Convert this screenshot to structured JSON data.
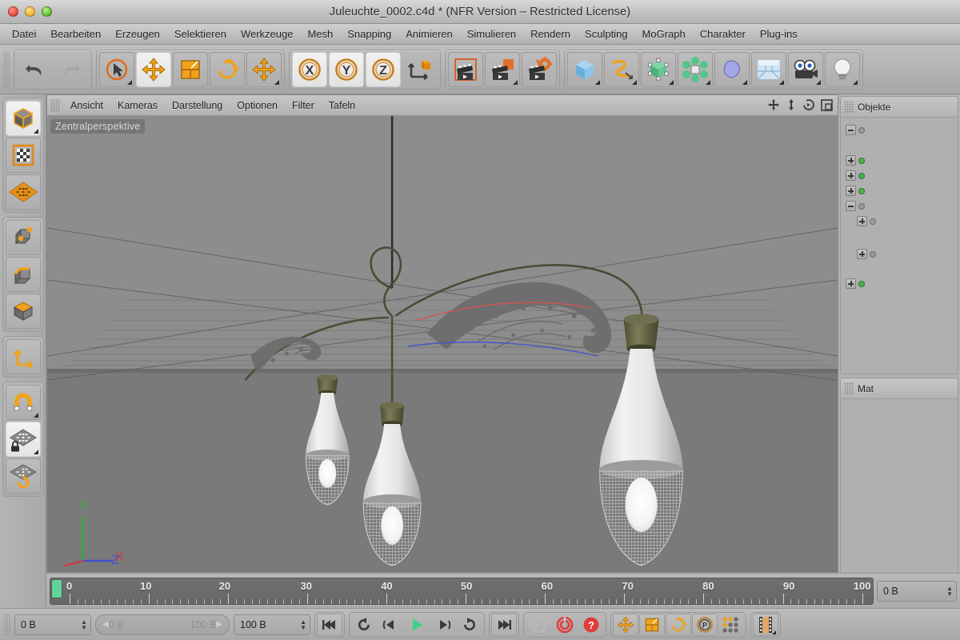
{
  "window": {
    "title": "Juleuchte_0002.c4d * (NFR Version – Restricted License)",
    "traffic": {
      "close": "close-button",
      "minimize": "minimize-button",
      "zoom": "zoom-button"
    }
  },
  "menubar": {
    "items": [
      {
        "label": "Datei"
      },
      {
        "label": "Bearbeiten"
      },
      {
        "label": "Erzeugen"
      },
      {
        "label": "Selektieren"
      },
      {
        "label": "Werkzeuge"
      },
      {
        "label": "Mesh"
      },
      {
        "label": "Snapping"
      },
      {
        "label": "Animieren"
      },
      {
        "label": "Simulieren"
      },
      {
        "label": "Rendern"
      },
      {
        "label": "Sculpting"
      },
      {
        "label": "MoGraph"
      },
      {
        "label": "Charakter"
      },
      {
        "label": "Plug-ins"
      }
    ]
  },
  "toolbar": {
    "groups": [
      {
        "name": "history",
        "buttons": [
          {
            "name": "undo-icon",
            "label": "Rückgängig"
          },
          {
            "name": "redo-icon",
            "label": "Wiederherstellen"
          }
        ]
      },
      {
        "name": "transform-tools",
        "buttons": [
          {
            "name": "select-live-icon",
            "label": "Selektion"
          },
          {
            "name": "move-icon",
            "label": "Verschieben"
          },
          {
            "name": "scale-icon",
            "label": "Skalieren"
          },
          {
            "name": "rotate-icon",
            "label": "Drehen"
          },
          {
            "name": "move-alt-icon",
            "label": "Verschieben (Alt)"
          }
        ]
      },
      {
        "name": "axis-locks",
        "buttons": [
          {
            "name": "axis-x-icon",
            "label": "X"
          },
          {
            "name": "axis-y-icon",
            "label": "Y"
          },
          {
            "name": "axis-z-icon",
            "label": "Z"
          },
          {
            "name": "world-object-coords-icon",
            "label": "Welt-/Objektsystem"
          }
        ]
      },
      {
        "name": "render-tools",
        "buttons": [
          {
            "name": "render-view-icon",
            "label": "Ansicht rendern"
          },
          {
            "name": "render-region-icon",
            "label": "Bereich rendern"
          },
          {
            "name": "render-settings-icon",
            "label": "Rendervoreinstellungen"
          }
        ]
      },
      {
        "name": "create-tools",
        "buttons": [
          {
            "name": "cube-primitive-icon",
            "label": "Grundobjekt"
          },
          {
            "name": "spline-icon",
            "label": "Spline"
          },
          {
            "name": "generator-icon",
            "label": "NURBS"
          },
          {
            "name": "array-icon",
            "label": "Modeling-Objekt"
          },
          {
            "name": "deformer-icon",
            "label": "Deformer"
          },
          {
            "name": "environment-icon",
            "label": "Szenenobjekt"
          },
          {
            "name": "camera-icon",
            "label": "Kamera"
          },
          {
            "name": "light-icon",
            "label": "Licht"
          }
        ]
      }
    ]
  },
  "left_palette": {
    "groups": [
      {
        "name": "mode-group-1",
        "buttons": [
          {
            "name": "object-mode-icon",
            "label": "Objekt-Modus"
          },
          {
            "name": "texture-mode-icon",
            "label": "Textur-Modus"
          },
          {
            "name": "workplane-icon",
            "label": "Arbeitsebene"
          }
        ]
      },
      {
        "name": "component-group",
        "buttons": [
          {
            "name": "point-mode-icon",
            "label": "Punkte-Modus"
          },
          {
            "name": "edge-mode-icon",
            "label": "Kanten-Modus"
          },
          {
            "name": "polygon-mode-icon",
            "label": "Polygone-Modus"
          }
        ]
      },
      {
        "name": "axis-group",
        "buttons": [
          {
            "name": "axis-mode-icon",
            "label": "Achse bearbeiten"
          }
        ]
      },
      {
        "name": "snap-group",
        "buttons": [
          {
            "name": "magnet-icon",
            "label": "Magnet"
          },
          {
            "name": "lock-workplane-icon",
            "label": "Arbeitsebene fixieren"
          },
          {
            "name": "workplane-rotate-icon",
            "label": "Arbeitsebene drehen"
          }
        ]
      }
    ]
  },
  "viewport": {
    "menu": [
      {
        "label": "Ansicht"
      },
      {
        "label": "Kameras"
      },
      {
        "label": "Darstellung"
      },
      {
        "label": "Optionen"
      },
      {
        "label": "Filter"
      },
      {
        "label": "Tafeln"
      }
    ],
    "corner_icons": [
      {
        "name": "pan-view-icon"
      },
      {
        "name": "dolly-view-icon"
      },
      {
        "name": "rotate-view-icon"
      },
      {
        "name": "maximize-view-icon"
      }
    ],
    "camera_label": "Zentralperspektive",
    "axis_gizmo": {
      "y": "Y",
      "x": "X",
      "z": "Z",
      "colors": {
        "y": "#2fae45",
        "x": "#cf3a3a",
        "z": "#4050cc"
      }
    },
    "scene": {
      "description": "Drei hängende Lampen mit Drahtgitter-Schirmen an einem verzierten Ausleger",
      "lamp_count": 3
    }
  },
  "object_manager": {
    "title": "Objekte",
    "rows": [
      {
        "expander": "minus",
        "dot": "grey",
        "name": ""
      },
      {
        "expander": "none",
        "dot": "grey",
        "name": ""
      },
      {
        "expander": "plus",
        "dot": "green",
        "name": ""
      },
      {
        "expander": "plus",
        "dot": "green",
        "name": ""
      },
      {
        "expander": "plus",
        "dot": "green",
        "name": ""
      },
      {
        "expander": "minus",
        "dot": "grey",
        "name": ""
      },
      {
        "expander": "plus",
        "dot": "grey",
        "name": ""
      },
      {
        "expander": "plus",
        "dot": "grey",
        "name": ""
      },
      {
        "expander": "plus",
        "dot": "green",
        "name": ""
      }
    ]
  },
  "material_manager": {
    "title": "Mat"
  },
  "timeline": {
    "ticks": [
      "0",
      "10",
      "20",
      "30",
      "40",
      "50",
      "60",
      "70",
      "80",
      "90",
      "100"
    ],
    "min": 0,
    "max": 100,
    "playhead_frame": 0,
    "playhead_color": "#62d39a",
    "current_field": "0 B"
  },
  "transport": {
    "current_frame_field": "0 B",
    "range_start": "0 B",
    "range_end": "100 B",
    "end_frame_field": "100 B",
    "buttons": [
      {
        "name": "go-to-start-icon",
        "label": "Zum Anfang"
      },
      {
        "name": "previous-key-icon",
        "label": "Vorheriger Key"
      },
      {
        "name": "step-back-icon",
        "label": "Bild zurück"
      },
      {
        "name": "play-icon",
        "label": "Abspielen"
      },
      {
        "name": "step-forward-icon",
        "label": "Bild vor"
      },
      {
        "name": "next-key-icon",
        "label": "Nächster Key"
      },
      {
        "name": "go-to-end-icon",
        "label": "Zum Ende"
      }
    ],
    "record_buttons": [
      {
        "name": "autokey-icon",
        "label": "Automatisches Keyframing"
      },
      {
        "name": "record-icon",
        "label": "Key aufzeichnen"
      },
      {
        "name": "help-icon",
        "label": "Hilfe"
      }
    ],
    "key_toggles": [
      {
        "name": "key-position-icon",
        "label": "Position"
      },
      {
        "name": "key-scale-icon",
        "label": "Größe"
      },
      {
        "name": "key-rotation-icon",
        "label": "Winkel"
      },
      {
        "name": "key-parameter-icon",
        "label": "Parameter"
      },
      {
        "name": "key-pla-icon",
        "label": "PLA"
      }
    ],
    "filmstrip": {
      "name": "filmstrip-icon",
      "label": "Animationsmodus"
    }
  },
  "colors": {
    "accent_orange": "#e8920e",
    "chrome": "#b4b4b4",
    "viewport_bg": "#8a8a8a",
    "playhead_green": "#62d39a",
    "record_red": "#e03b3b"
  }
}
